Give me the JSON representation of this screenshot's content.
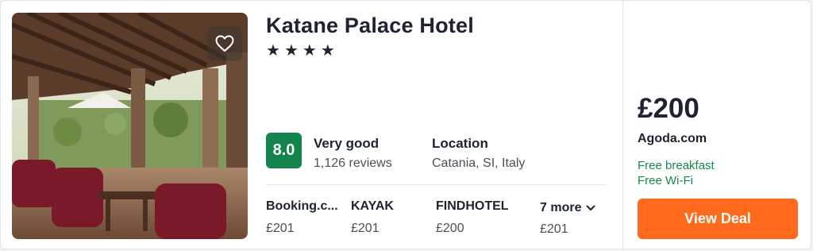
{
  "hotel": {
    "name": "Katane Palace Hotel",
    "stars": [
      "★",
      "★",
      "★",
      "★"
    ],
    "rating": {
      "score": "8.0",
      "label": "Very good",
      "reviews": "1,126 reviews",
      "color": "#13844b"
    },
    "location": {
      "label": "Location",
      "value": "Catania, SI, Italy"
    },
    "favorite_icon": "heart-outline-icon"
  },
  "providers": [
    {
      "name": "Booking.c...",
      "price": "£201"
    },
    {
      "name": "KAYAK",
      "price": "£201"
    },
    {
      "name": "FINDHOTEL",
      "price": "£200"
    }
  ],
  "more": {
    "label": "7 more",
    "price": "£201",
    "icon": "chevron-down-icon"
  },
  "deal": {
    "price": "£200",
    "site": "Agoda.com",
    "perks": [
      "Free breakfast",
      "Free Wi-Fi"
    ],
    "button_label": "View Deal",
    "button_color": "#ff6a1c",
    "perk_color": "#138a4c"
  }
}
